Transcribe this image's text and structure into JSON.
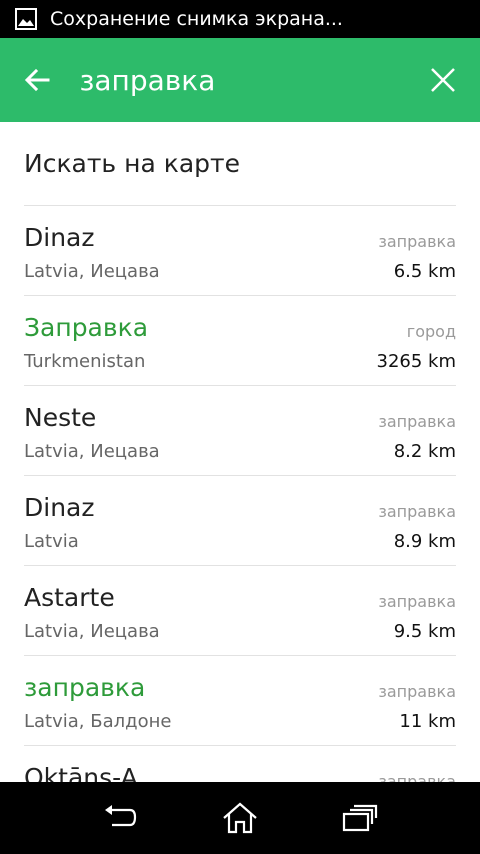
{
  "theme": {
    "accent": "#2dbb6a",
    "highlight": "#2e9b3a"
  },
  "status_bar": {
    "text": "Сохранение снимка экрана...",
    "icon": "image-icon"
  },
  "app_bar": {
    "back_icon": "arrow-left-icon",
    "query": "заправка",
    "clear_icon": "close-icon"
  },
  "search_on_map": "Искать на карте",
  "results": [
    {
      "name": "Dinaz",
      "location": "Latvia, Иецава",
      "type": "заправка",
      "distance": "6.5 km",
      "highlight": false
    },
    {
      "name": "Заправка",
      "location": "Turkmenistan",
      "type": "город",
      "distance": "3265 km",
      "highlight": true
    },
    {
      "name": "Neste",
      "location": "Latvia, Иецава",
      "type": "заправка",
      "distance": "8.2 km",
      "highlight": false
    },
    {
      "name": "Dinaz",
      "location": "Latvia",
      "type": "заправка",
      "distance": "8.9 km",
      "highlight": false
    },
    {
      "name": "Astarte",
      "location": "Latvia, Иецава",
      "type": "заправка",
      "distance": "9.5 km",
      "highlight": false
    },
    {
      "name": "заправка",
      "location": "Latvia, Балдоне",
      "type": "заправка",
      "distance": "11 km",
      "highlight": true
    },
    {
      "name": "Oktāns-A",
      "location": "",
      "type": "заправка",
      "distance": "",
      "highlight": false
    }
  ],
  "nav_bar": {
    "back_icon": "nav-back-icon",
    "home_icon": "nav-home-icon",
    "recent_icon": "nav-recent-apps-icon"
  }
}
